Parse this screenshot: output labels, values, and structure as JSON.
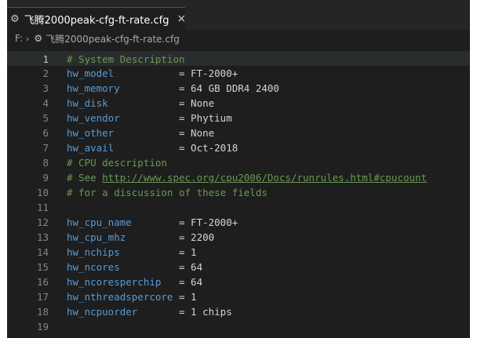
{
  "tab": {
    "title": "飞腾2000peak-cfg-ft-rate.cfg",
    "close_glyph": "×",
    "icon": "gear-icon"
  },
  "breadcrumb": {
    "drive": "F:",
    "separator": "›",
    "file": "飞腾2000peak-cfg-ft-rate.cfg"
  },
  "lines": [
    {
      "n": "1",
      "type": "comment",
      "text": "# System Description"
    },
    {
      "n": "2",
      "type": "kv",
      "key": "hw_model           ",
      "rest": "= FT-2000+"
    },
    {
      "n": "3",
      "type": "kv",
      "key": "hw_memory          ",
      "rest": "= 64 GB DDR4 2400"
    },
    {
      "n": "4",
      "type": "kv",
      "key": "hw_disk            ",
      "rest": "= None"
    },
    {
      "n": "5",
      "type": "kv",
      "key": "hw_vendor          ",
      "rest": "= Phytium"
    },
    {
      "n": "6",
      "type": "kv",
      "key": "hw_other           ",
      "rest": "= None"
    },
    {
      "n": "7",
      "type": "kv",
      "key": "hw_avail           ",
      "rest": "= Oct-2018"
    },
    {
      "n": "8",
      "type": "comment",
      "text": "# CPU description"
    },
    {
      "n": "9",
      "type": "link",
      "prefix": "# See ",
      "link": "http://www.spec.org/cpu2006/Docs/runrules.html#cpucount"
    },
    {
      "n": "10",
      "type": "comment",
      "text": "# for a discussion of these fields"
    },
    {
      "n": "11",
      "type": "empty"
    },
    {
      "n": "12",
      "type": "kv",
      "key": "hw_cpu_name        ",
      "rest": "= FT-2000+"
    },
    {
      "n": "13",
      "type": "kv",
      "key": "hw_cpu_mhz         ",
      "rest": "= 2200"
    },
    {
      "n": "14",
      "type": "kv",
      "key": "hw_nchips          ",
      "rest": "= 1"
    },
    {
      "n": "15",
      "type": "kv",
      "key": "hw_ncores          ",
      "rest": "= 64"
    },
    {
      "n": "16",
      "type": "kv",
      "key": "hw_ncoresperchip   ",
      "rest": "= 64"
    },
    {
      "n": "17",
      "type": "kv",
      "key": "hw_nthreadspercore ",
      "rest": "= 1"
    },
    {
      "n": "18",
      "type": "kv",
      "key": "hw_ncpuorder       ",
      "rest": "= 1 chips"
    },
    {
      "n": "19",
      "type": "empty"
    }
  ],
  "active_line": "1"
}
